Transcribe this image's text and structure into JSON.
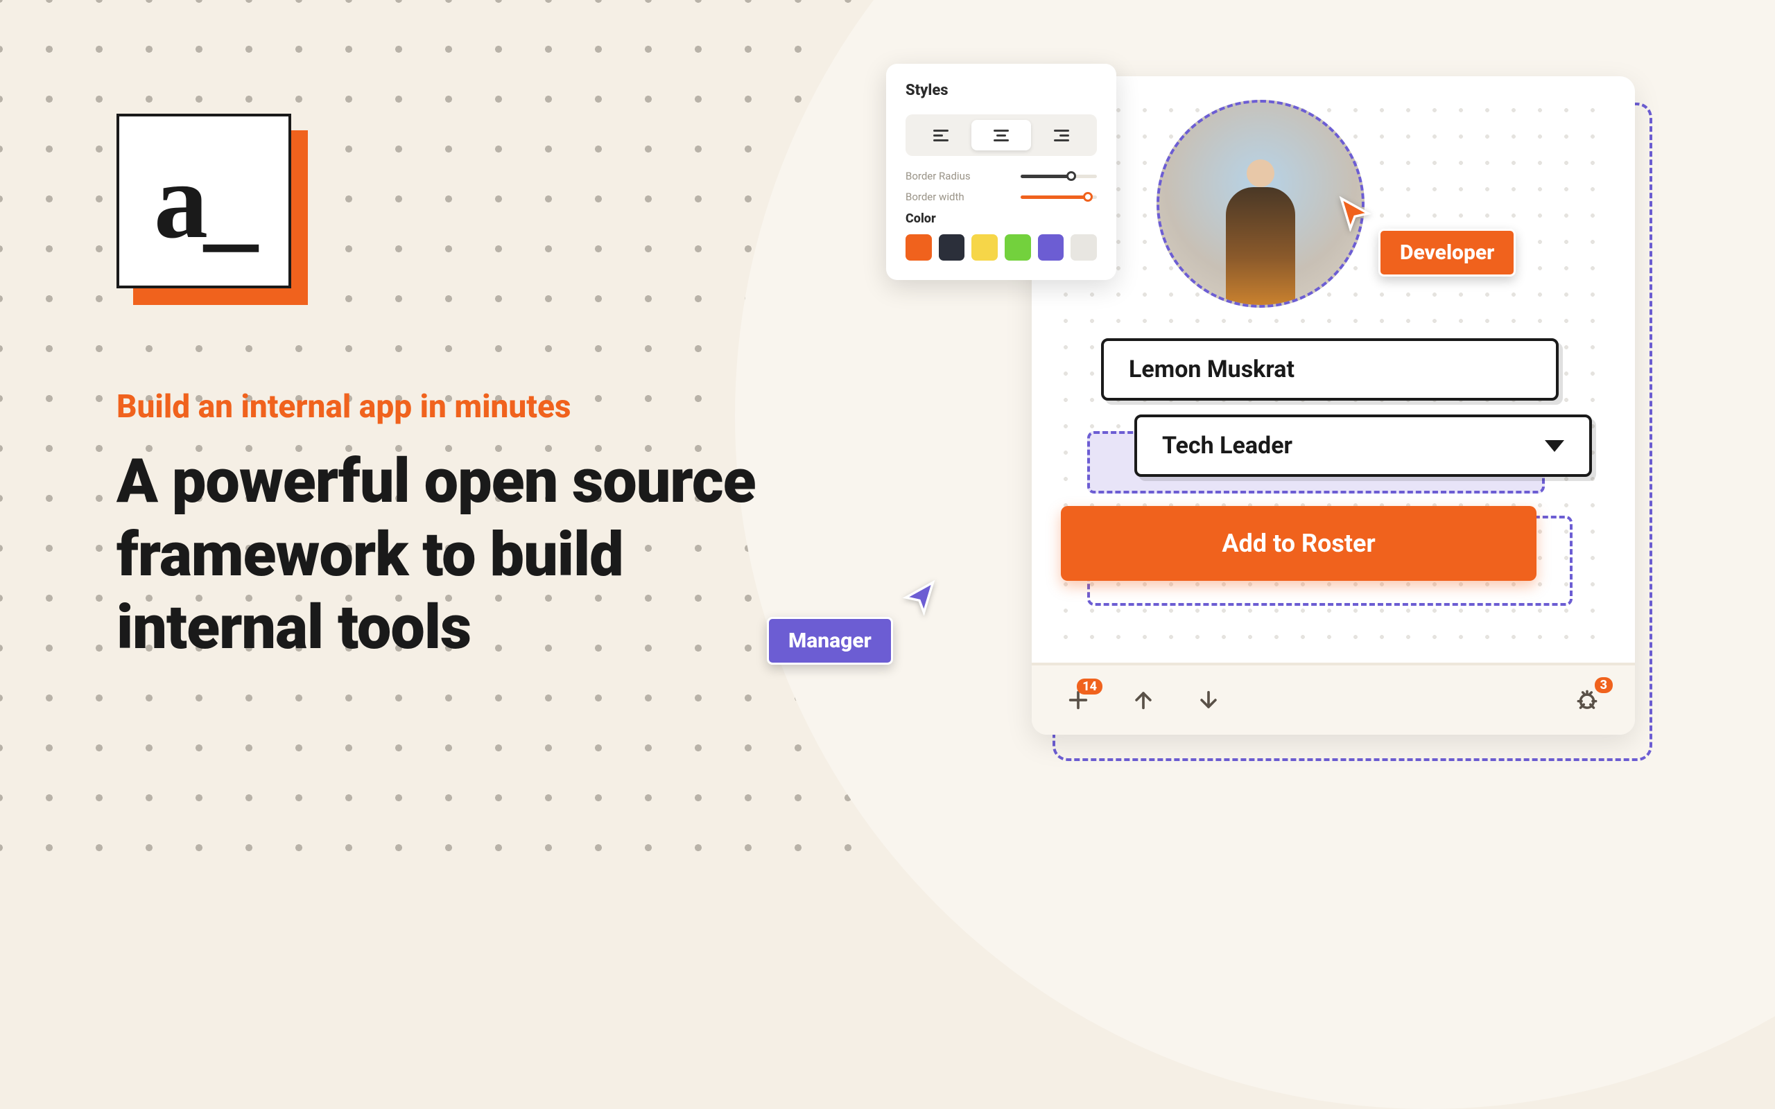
{
  "logo": "a_",
  "tagline": "Build an internal app in minutes",
  "headline": "A powerful open source framework to build internal tools",
  "styles_panel": {
    "title": "Styles",
    "border_radius_label": "Border Radius",
    "border_width_label": "Border width",
    "color_label": "Color",
    "swatches": [
      "#f0621d",
      "#2b2f3a",
      "#f6d648",
      "#73d13d",
      "#6c5dd3",
      "#e8e6e1"
    ]
  },
  "form": {
    "name_value": "Lemon Muskrat",
    "role_value": "Tech Leader",
    "button_label": "Add to Roster"
  },
  "bottom_bar": {
    "add_badge": "14",
    "bug_badge": "3"
  },
  "cursors": {
    "developer": "Developer",
    "manager": "Manager"
  }
}
